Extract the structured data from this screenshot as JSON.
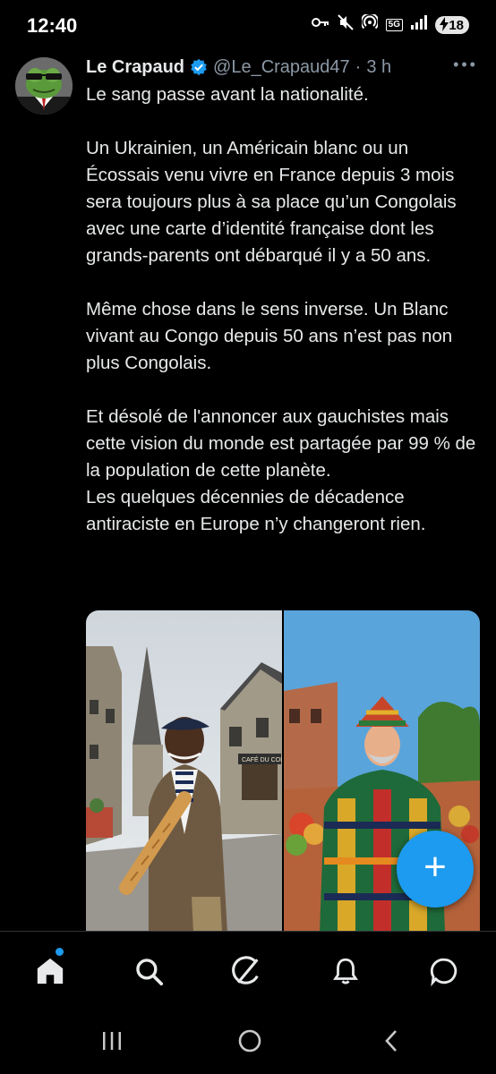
{
  "status_bar": {
    "time": "12:40",
    "network_label": "5G",
    "battery_level": "18"
  },
  "tweet": {
    "author_name": "Le Crapaud",
    "handle": "@Le_Crapaud47",
    "separator": "·",
    "time_ago": "3 h",
    "more_glyph": "• • •",
    "verified": true,
    "paragraphs": [
      "Le sang passe avant la nationalité.",
      "Un Ukrainien, un Américain blanc ou un Écossais venu vivre en France depuis 3 mois sera toujours plus à sa place qu’un Congolais avec une carte d’identité française dont les grands-parents ont débarqué il y a 50 ans.",
      "Même chose dans le sens inverse. Un Blanc vivant au Congo depuis 50 ans n’est pas non plus Congolais.",
      "Et désolé de l'annoncer aux gauchistes mais cette vision du monde est partagée par 99 % de la population de cette planète.",
      "Les quelques décennies de décadence antiraciste en Europe n’y changeront rien."
    ],
    "media": {
      "left_shop_sign": "CAFÉ DU COIN",
      "left_alt": "man-with-baguette-and-beret-in-french-village",
      "right_alt": "man-in-kente-outfit-at-african-market"
    }
  },
  "fab": {
    "label": "+"
  },
  "bottom_nav": {
    "items": [
      "home",
      "search",
      "grok",
      "notifications",
      "messages"
    ],
    "home_has_badge": true
  },
  "colors": {
    "accent": "#1d9bf0",
    "background": "#000000",
    "text_primary": "#e7e9ea",
    "text_secondary": "#8b98a5"
  }
}
